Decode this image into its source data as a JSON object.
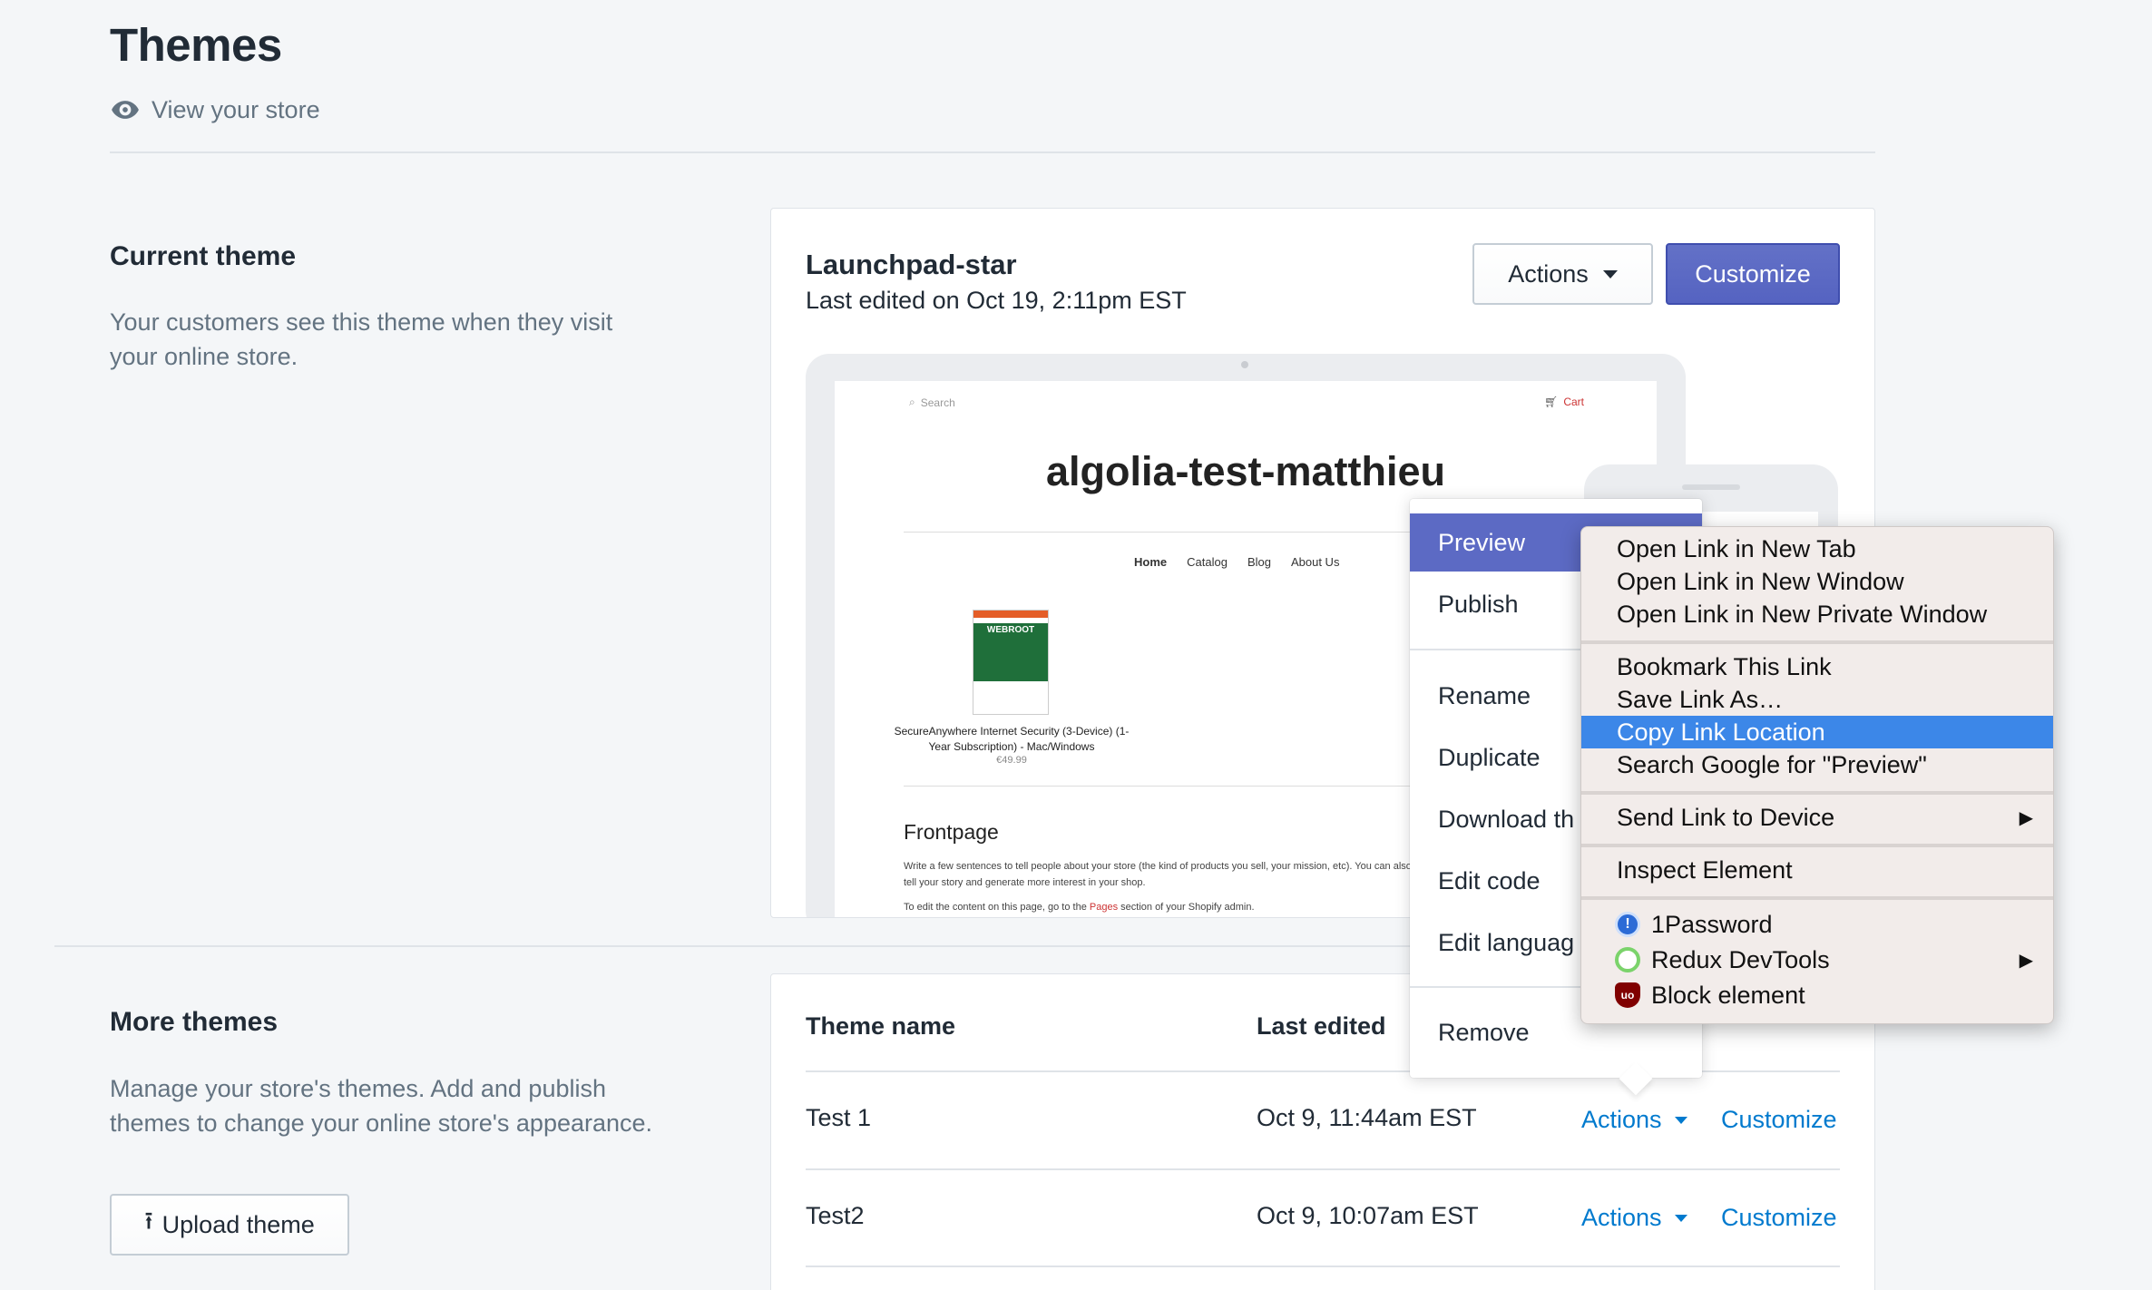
{
  "header": {
    "title": "Themes",
    "view_store": "View your store"
  },
  "current_theme": {
    "section_title": "Current theme",
    "section_desc": "Your customers see this theme when they visit your online store.",
    "name": "Launchpad-star",
    "last_edited": "Last edited on Oct 19, 2:11pm EST",
    "actions_label": "Actions",
    "customize_label": "Customize",
    "preview": {
      "search": "Search",
      "cart": "Cart",
      "store_name": "algolia-test-matthieu",
      "nav": [
        "Home",
        "Catalog",
        "Blog",
        "About Us"
      ],
      "product_title": "SecureAnywhere Internet Security (3-Device) (1-Year Subscription) - Mac/Windows",
      "product_price": "€49.99",
      "product_image_text": "WEBROOT",
      "frontpage_heading": "Frontpage",
      "frontpage_text": "Write a few sentences to tell people about your store (the kind of products you sell, your mission, etc). You can also add images, videos, and links to help tell your story and generate more interest in your shop.",
      "edit_text_prefix": "To edit the content on this page, go to the",
      "edit_text_link": "Pages",
      "edit_text_suffix": "section of your Shopify admin."
    }
  },
  "more_themes": {
    "section_title": "More themes",
    "section_desc": "Manage your store's themes. Add and publish themes to change your online store's appearance.",
    "upload_label": "Upload theme",
    "columns": [
      "Theme name",
      "Last edited"
    ],
    "rows": [
      {
        "name": "Test 1",
        "edited": "Oct 9, 11:44am EST",
        "actions": "Actions",
        "customize": "Customize"
      },
      {
        "name": "Test2",
        "edited": "Oct 9, 10:07am EST",
        "actions": "Actions",
        "customize": "Customize"
      }
    ]
  },
  "actions_menu": {
    "items": [
      "Preview",
      "Publish",
      "Rename",
      "Duplicate",
      "Download th",
      "Edit code",
      "Edit languag",
      "Remove"
    ]
  },
  "context_menu": {
    "items": [
      "Open Link in New Tab",
      "Open Link in New Window",
      "Open Link in New Private Window",
      "Bookmark This Link",
      "Save Link As…",
      "Copy Link Location",
      "Search Google for \"Preview\"",
      "Send Link to Device",
      "Inspect Element",
      "1Password",
      "Redux DevTools",
      "Block element"
    ],
    "submenu_arrow": "▶"
  },
  "colors": {
    "primary": "#5c6ac4",
    "link": "#007ace",
    "context_highlight": "#3c87e8"
  }
}
